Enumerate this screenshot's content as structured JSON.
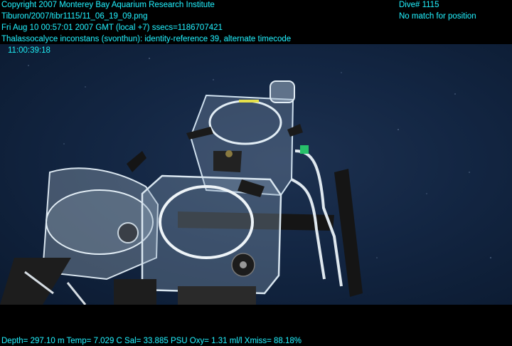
{
  "overlay": {
    "copyright": "Copyright 2007 Monterey Bay Aquarium Research Institute",
    "filepath": "Tiburon/2007/tibr1115/11_06_19_09.png",
    "datetime": "Fri Aug 10 00:57:01 2007 GMT (local +7)  ssecs=1186707421",
    "annotation": "Thalassocalyce inconstans (svonthun): identity-reference 39, alternate timecode",
    "timecode": "11:00:39:18",
    "dive": "Dive# 1115",
    "position": "No match for position",
    "sensors": "Depth= 297.10 m  Temp= 7.029 C  Sal= 33.885 PSU  Oxy= 1.31 ml/l  Xmiss= 88.18%"
  },
  "colors": {
    "overlay_text": "#22e6f2",
    "water": "#132643",
    "frame": "#000000"
  }
}
